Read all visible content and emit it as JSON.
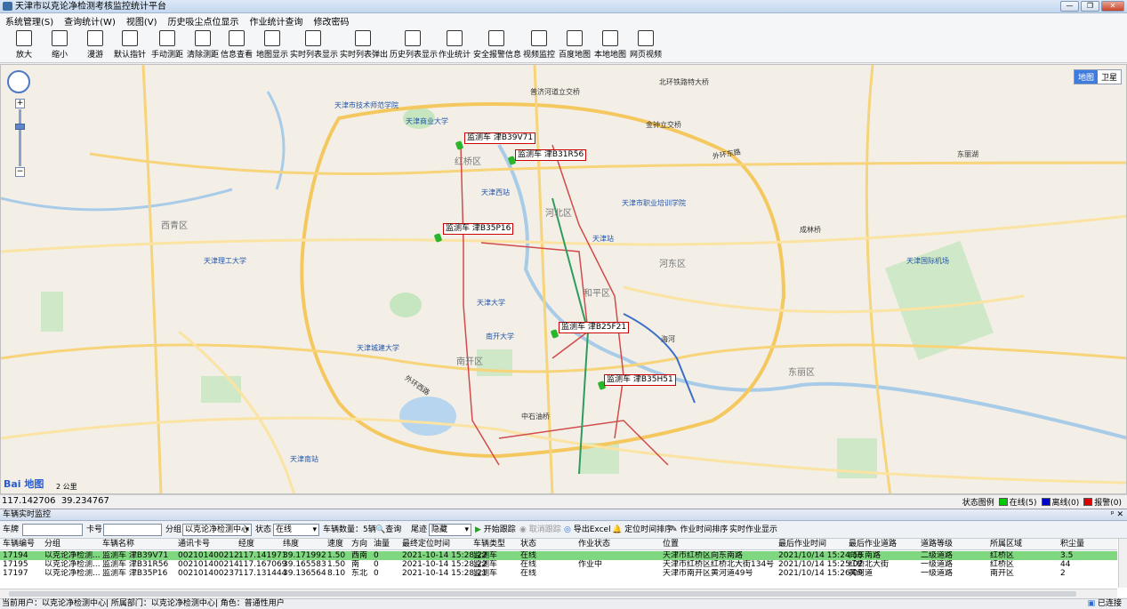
{
  "window": {
    "title": "天津市以克论净检测考核监控统计平台"
  },
  "menu": [
    "系统管理(S)",
    "查询统计(W)",
    "视图(V)",
    "历史吸尘点位显示",
    "作业统计查询",
    "修改密码"
  ],
  "toolbar": [
    "放大",
    "缩小",
    "漫游",
    "默认指针",
    "手动测距",
    "清除测距",
    "信息查看",
    "地图显示",
    "实时列表显示",
    "实时列表弹出",
    "历史列表显示",
    "作业统计",
    "安全报警信息",
    "视频监控",
    "百度地图",
    "本地地图",
    "网页视频"
  ],
  "map": {
    "type_buttons": [
      "地图",
      "卫星"
    ],
    "baidu_logo": "Bai 地图",
    "scale": "2 公里",
    "vehicles": [
      {
        "label": "监测车 津B39V71"
      },
      {
        "label": "监测车 津B31R56"
      },
      {
        "label": "监测车 津B35P16"
      },
      {
        "label": "监测车 津B25F21"
      },
      {
        "label": "监测车 津B35H51"
      }
    ],
    "labels": [
      "北环铁路特大桥",
      "普济河道立交桥",
      "天津市技术师范学院",
      "天津市职业培训学院",
      "天津商业大学",
      "天津国际机场",
      "天津城建大学",
      "天津理工大学",
      "南开大学",
      "天津大学",
      "天津站",
      "天津西站",
      "天津南站",
      "红桥区",
      "河北区",
      "河东区",
      "南开区",
      "西青区",
      "东丽区",
      "和平区",
      "中石油桥",
      "外环西路",
      "外环东路",
      "海河",
      "成林桥",
      "金钟立交桥",
      "东丽湖"
    ]
  },
  "coords": {
    "lng": "117.142706",
    "lat": "39.234767"
  },
  "legend": {
    "title": "状态图例",
    "online": "在线(5)",
    "offline": "离线(0)",
    "alarm": "报警(0)",
    "colors": {
      "online": "#00cc00",
      "offline": "#0000cc",
      "alarm": "#dd0000"
    }
  },
  "panel": {
    "title": "车辆实时监控",
    "filters": {
      "plate_label": "车牌",
      "plate_value": "",
      "card_label": "卡号",
      "card_value": "",
      "group_label": "分组",
      "group_value": "以克论净检测中心",
      "status_label": "状态",
      "status_value": "在线",
      "count_label": "车辆数量：5辆",
      "query": "查询",
      "tail_label": "尾迹",
      "tail_value": "隐藏",
      "start_track": "开始跟踪",
      "cancel_track": "取消跟踪",
      "export": "导出Excel",
      "pos_sort": "定位时间排序",
      "work_sort": "作业时间排序",
      "realtime_work": "实时作业显示"
    },
    "columns": [
      "车辆编号",
      "分组",
      "车辆名称",
      "通讯卡号",
      "经度",
      "纬度",
      "速度",
      "方向",
      "油量",
      "最终定位时间",
      "车辆类型",
      "状态",
      "作业状态",
      "位置",
      "最后作业时间",
      "最后作业道路",
      "道路等级",
      "所属区域",
      "积尘量"
    ],
    "rows": [
      [
        "17194",
        "以克论净检测...",
        "监测车 津B39V71",
        "002101400212",
        "117.141971",
        "39.171992",
        "1.50",
        "西南",
        "0",
        "2021-10-14 15:28:22",
        "监测车",
        "在线",
        "",
        "天津市红桥区向东南路",
        "2021/10/14 15:24:58",
        "向东南路",
        "二级道路",
        "红桥区",
        "3.5"
      ],
      [
        "17195",
        "以克论净检测...",
        "监测车 津B31R56",
        "002101400214",
        "117.167069",
        "39.165583",
        "1.50",
        "南",
        "0",
        "2021-10-14 15:28:22",
        "监测车",
        "在线",
        "作业中",
        "天津市红桥区红桥北大街134号",
        "2021/10/14 15:25:02",
        "红桥北大街",
        "一级道路",
        "红桥区",
        "44"
      ],
      [
        "17197",
        "以克论净检测...",
        "监测车 津B35P16",
        "002101400237",
        "117.131444",
        "39.136564",
        "8.10",
        "东北",
        "0",
        "2021-10-14 15:28:21",
        "监测车",
        "在线",
        "",
        "天津市南开区黄河道49号",
        "2021/10/14 15:26:09",
        "黄河道",
        "一级道路",
        "南开区",
        "2"
      ]
    ]
  },
  "status": {
    "user": "当前用户：以克论净检测中心| 所属部门：以克论净检测中心| 角色：普通性用户",
    "connected": "已连接"
  }
}
